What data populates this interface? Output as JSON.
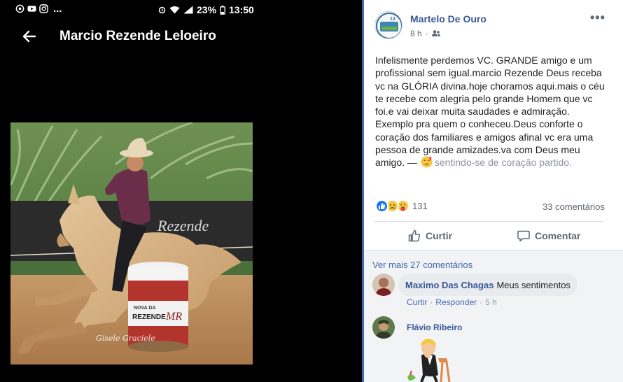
{
  "status_bar": {
    "icons_left": [
      "whatsapp-icon",
      "youtube-icon",
      "instagram-icon"
    ],
    "more": "...",
    "icons_right": [
      "alarm-icon",
      "wifi-icon",
      "signal-icon"
    ],
    "battery": "23%",
    "time": "13:50"
  },
  "phone": {
    "title": "Marcio Rezende Leloeiro",
    "photo": {
      "banner_text": "Rezende",
      "barrel_text_small": "NOVA DA",
      "barrel_text": "REZENDE",
      "barrel_logo": "MR",
      "watermark": "Gisele Graciele"
    }
  },
  "post": {
    "page_name": "Martelo De Ouro",
    "time": "8 h",
    "audience_icon": "friends-icon",
    "more": "•••",
    "text": "Infelismente perdemos VC. GRANDE amigo e um profissional sem igual.marcio Rezende Deus receba vc na GLÓRIA divina.hoje choramos aqui.mais o céu te recebe com alegria pelo grande Homem que vc foi.e vai deixar muita saudades e admiração. Exemplo pra quem o conheceu.Deus conforte o coração dos familiares e amigos afinal vc era uma pessoa de grande amizades.va com Deus meu amigo.",
    "dash": " — ",
    "feeling": "sentindo-se de coração partido.",
    "reactions": [
      "like",
      "sad",
      "care"
    ],
    "reaction_count": "131",
    "comments_count": "33 comentários",
    "actions": {
      "like": "Curtir",
      "comment": "Comentar"
    }
  },
  "comments": {
    "more_link": "Ver mais 27 comentários",
    "items": [
      {
        "author": "Maximo Das Chagas",
        "text": "Meus sentimentos",
        "like": "Curtir",
        "reply": "Responder",
        "time": "5 h"
      },
      {
        "author": "Flávio Ribeiro"
      }
    ]
  },
  "colors": {
    "fb_blue": "#4267b2",
    "link_blue": "#385898",
    "meta_gray": "#606770",
    "phone_bg": "#000000"
  }
}
